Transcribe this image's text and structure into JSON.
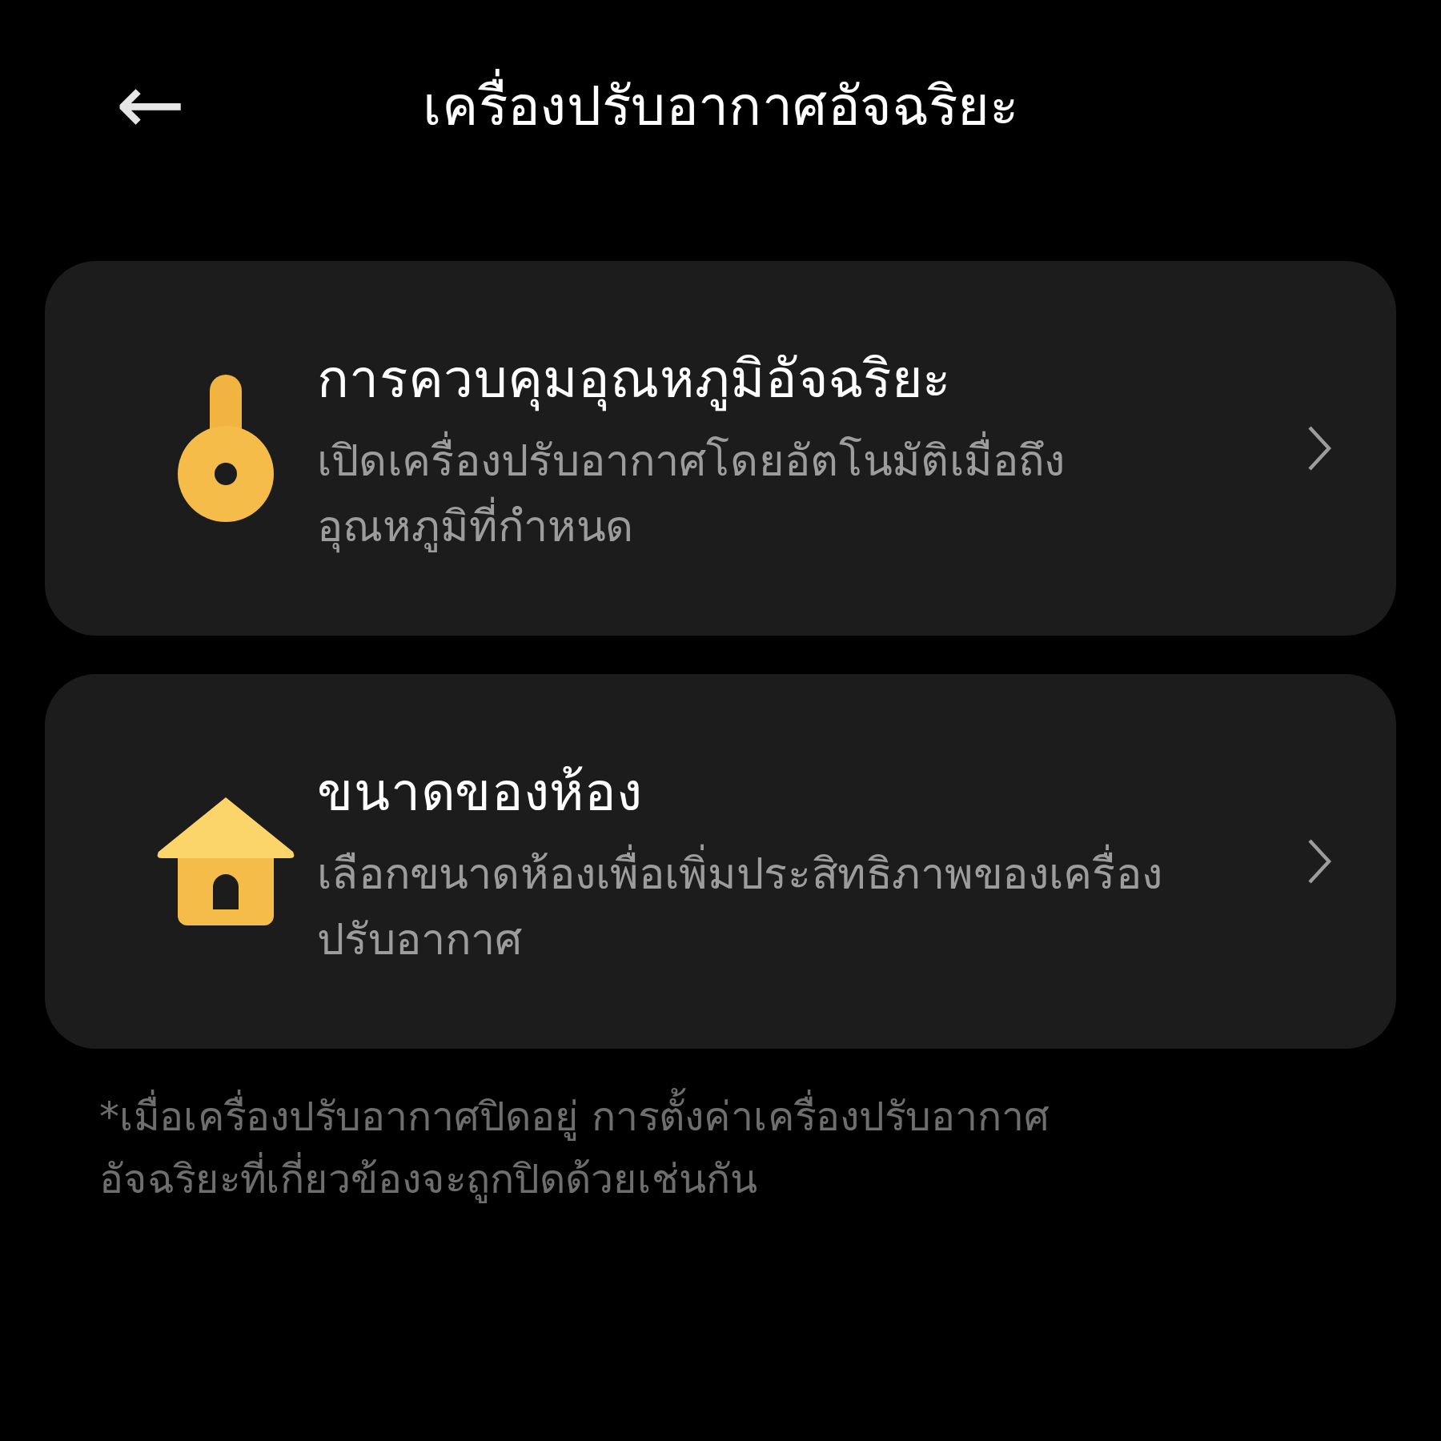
{
  "header": {
    "back": "←",
    "title": "เครื่องปรับอากาศอัจฉริยะ"
  },
  "items": [
    {
      "kind": "thermometer",
      "title": "การควบคุมอุณหภูมิอัจฉริยะ",
      "description": "เปิดเครื่องปรับอากาศโดยอัตโนมัติเมื่อถึงอุณหภูมิที่กำหนด"
    },
    {
      "kind": "house",
      "title": "ขนาดของห้อง",
      "description": "เลือกขนาดห้องเพื่อเพิ่มประสิทธิภาพของเครื่องปรับอากาศ"
    }
  ],
  "footnote": "*เมื่อเครื่องปรับอากาศปิดอยู่ การตั้งค่าเครื่องปรับอากาศอัจฉริยะที่เกี่ยวข้องจะถูกปิดด้วยเช่นกัน"
}
